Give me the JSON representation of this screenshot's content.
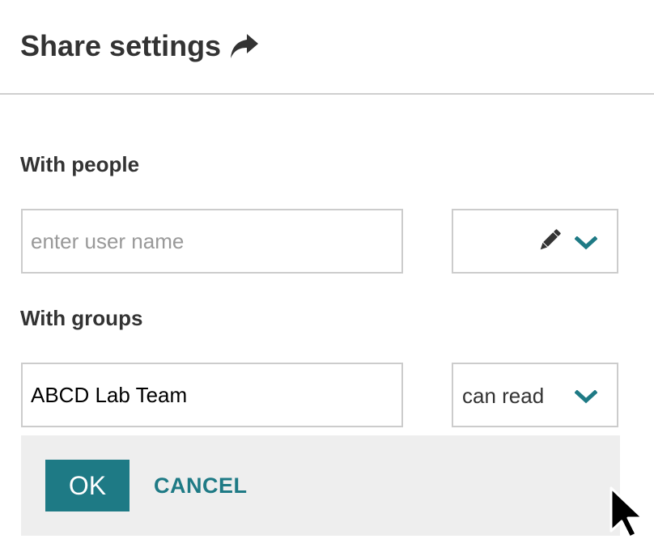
{
  "dialog": {
    "title": "Share settings",
    "title_icon": "share-arrow-icon"
  },
  "people": {
    "label": "With people",
    "input_value": "",
    "input_placeholder": "enter user name",
    "permission_icon": "pencil-icon",
    "dropdown_icon": "chevron-down-icon"
  },
  "groups": {
    "label": "With groups",
    "input_value": "ABCD Lab Team",
    "permission_value": "can read",
    "dropdown_icon": "chevron-down-icon"
  },
  "footer": {
    "ok_label": "OK",
    "cancel_label": "CANCEL"
  },
  "colors": {
    "accent": "#1e7a85",
    "text": "#333333",
    "border": "#cccccc",
    "footer_bg": "#eeeeee"
  }
}
